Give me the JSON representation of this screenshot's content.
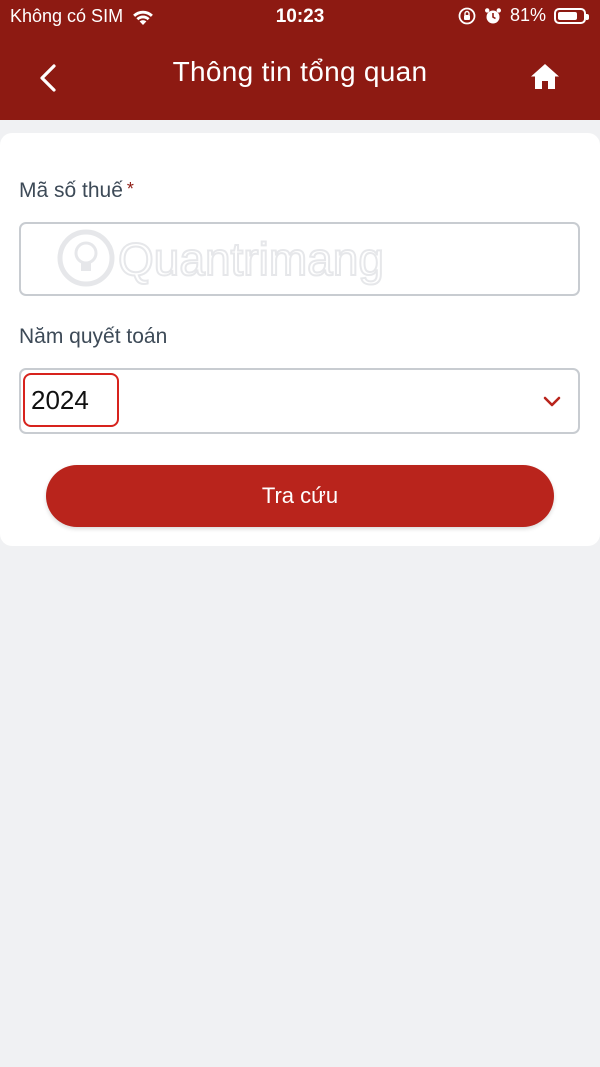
{
  "status_bar": {
    "carrier": "Không có SIM",
    "time": "10:23",
    "battery_percent_label": "81%",
    "battery_level": 0.81,
    "icons": [
      "wifi-icon",
      "orientation-lock-icon",
      "alarm-icon",
      "battery-icon"
    ]
  },
  "nav": {
    "title": "Thông tin tổng quan",
    "back_icon": "chevron-left-icon",
    "home_icon": "home-icon"
  },
  "form": {
    "tax_code_label": "Mã số thuế",
    "required_marker": "*",
    "tax_code_value": "",
    "year_label": "Năm quyết toán",
    "year_value": "2024",
    "search_button": "Tra cứu"
  },
  "watermark": {
    "text": "Quantrimang"
  },
  "colors": {
    "header": "#8d1a12",
    "button": "#b9241c",
    "highlight": "#d7231d",
    "background": "#f0f1f3"
  }
}
